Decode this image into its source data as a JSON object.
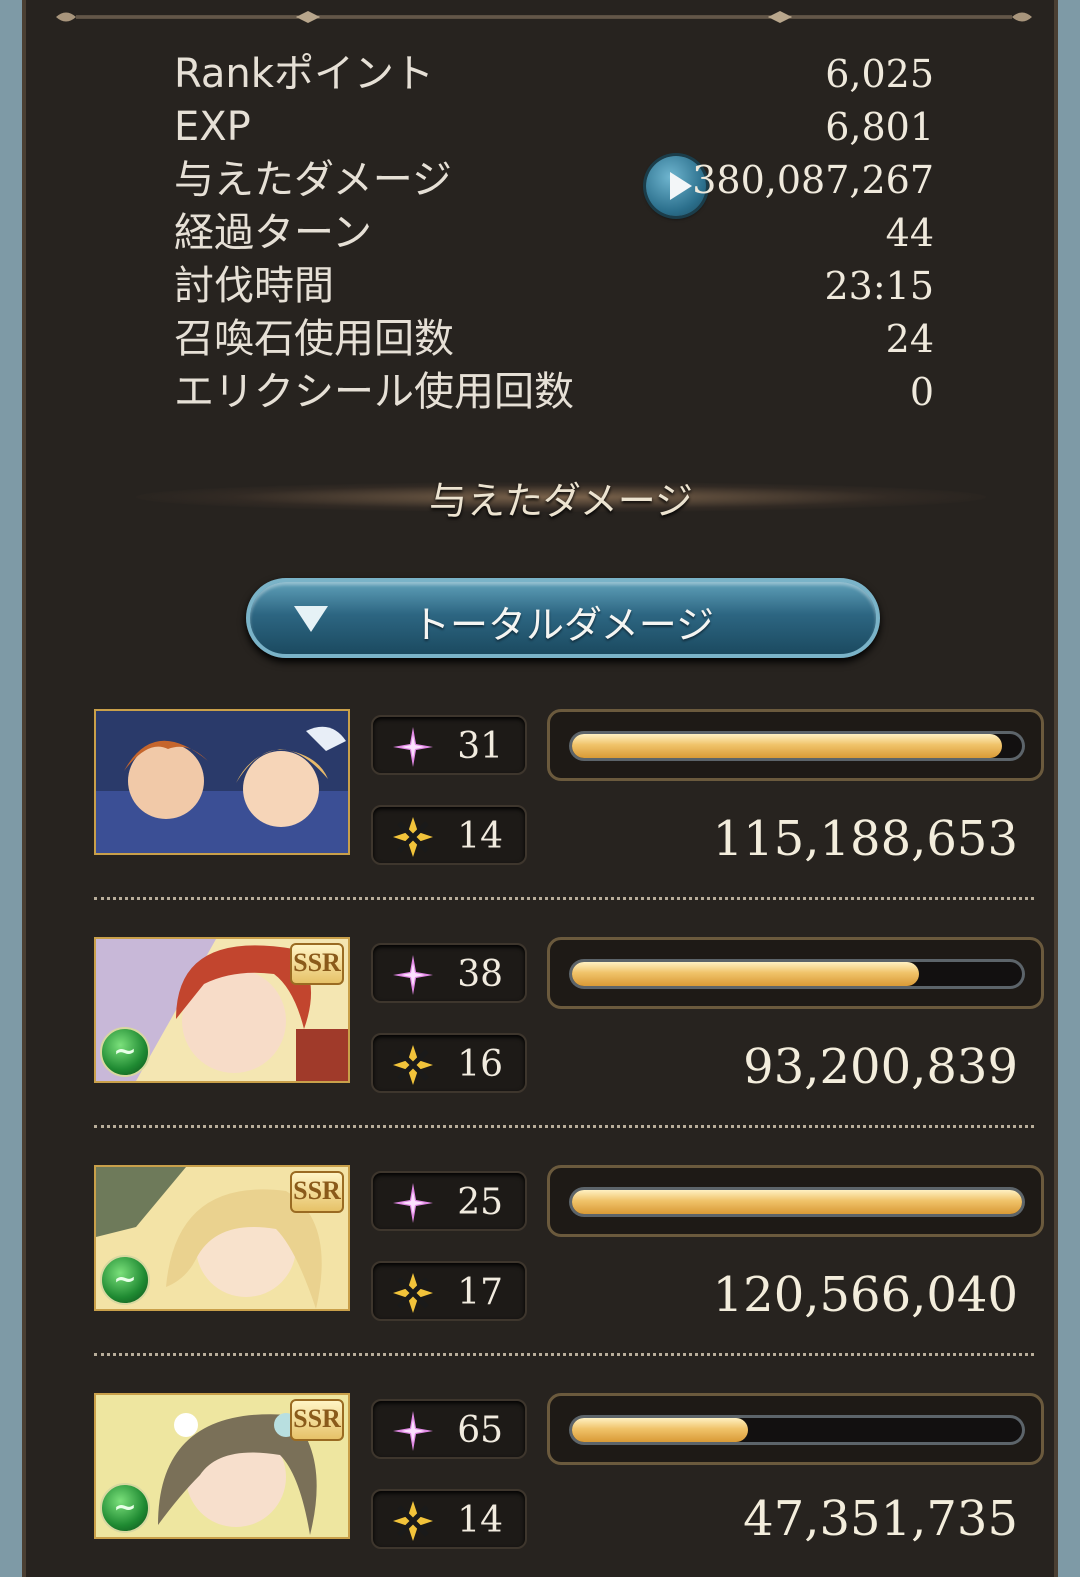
{
  "stats": [
    {
      "label": "Rankポイント",
      "value": "6,025"
    },
    {
      "label": "EXP",
      "value": "6,801"
    },
    {
      "label": "与えたダメージ",
      "value": "380,087,267"
    },
    {
      "label": "経過ターン",
      "value": "44"
    },
    {
      "label": "討伐時間",
      "value": "23:15"
    },
    {
      "label": "召喚石使用回数",
      "value": "24"
    },
    {
      "label": "エリクシール使用回数",
      "value": "0"
    }
  ],
  "damage_section": {
    "heading": "与えたダメージ",
    "dropdown_selected": "トータルダメージ"
  },
  "characters": [
    {
      "ssr": "",
      "element_icon": "",
      "ougi_count": "31",
      "skill_count": "14",
      "damage": "115,188,653",
      "bar_fraction": 0.955
    },
    {
      "ssr": "SSR",
      "element_icon": "wind-element-icon",
      "ougi_count": "38",
      "skill_count": "16",
      "damage": "93,200,839",
      "bar_fraction": 0.77
    },
    {
      "ssr": "SSR",
      "element_icon": "wind-element-icon",
      "ougi_count": "25",
      "skill_count": "17",
      "damage": "120,566,040",
      "bar_fraction": 1.0
    },
    {
      "ssr": "SSR",
      "element_icon": "wind-element-icon",
      "ougi_count": "65",
      "skill_count": "14",
      "damage": "47,351,735",
      "bar_fraction": 0.39
    }
  ],
  "colors": {
    "panel": "#27231f",
    "bar_fill": "#f0c36a",
    "dropdown": "#2d6682",
    "side_background": "#7e9aa6"
  }
}
